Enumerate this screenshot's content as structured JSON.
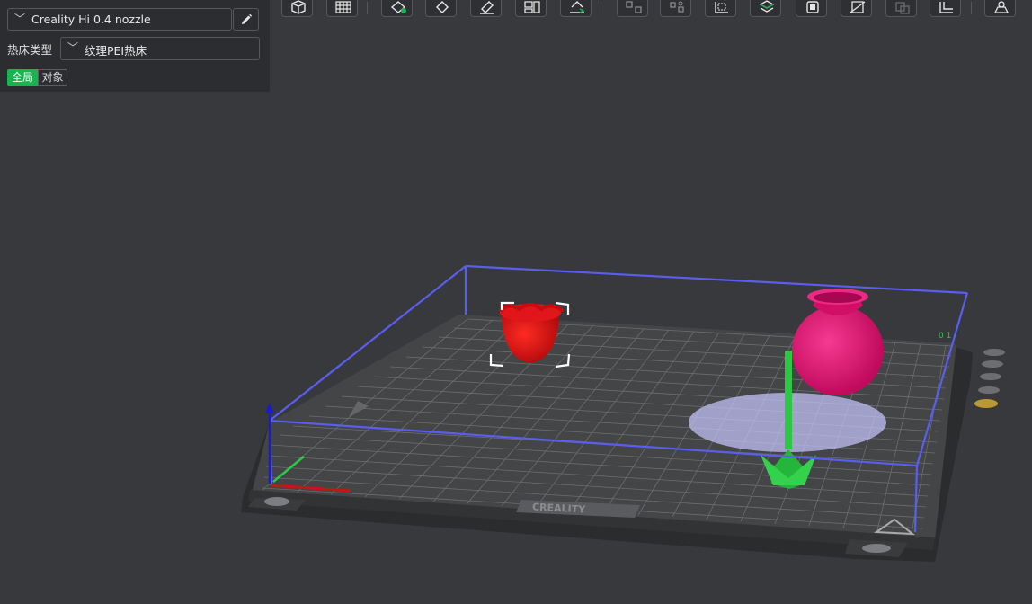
{
  "printer": {
    "selected": "Creality Hi 0.4 nozzle"
  },
  "bed": {
    "label": "热床类型",
    "selected": "纹理PEI热床"
  },
  "tabs": {
    "global": "全局",
    "object": "对象"
  },
  "bed_logo": "CREALITY",
  "colors": {
    "accent": "#17b44f",
    "object_red": "#d80f14",
    "object_magenta": "#e0116e",
    "object_green": "#2ec743",
    "build_volume": "#5a5ef0"
  },
  "toolbar_icons": [
    "add-cube-icon",
    "grid-plate-icon",
    "auto-arrange-icon",
    "orient-icon",
    "lay-on-face-icon",
    "split-icon",
    "flatten-icon",
    "cut-icon",
    "cut-parts-icon",
    "measure-icon",
    "variable-layer-icon",
    "support-paint-icon",
    "seam-paint-icon",
    "fuzzy-skin-icon",
    "boolean-icon",
    "text-icon",
    "assembly-icon"
  ]
}
